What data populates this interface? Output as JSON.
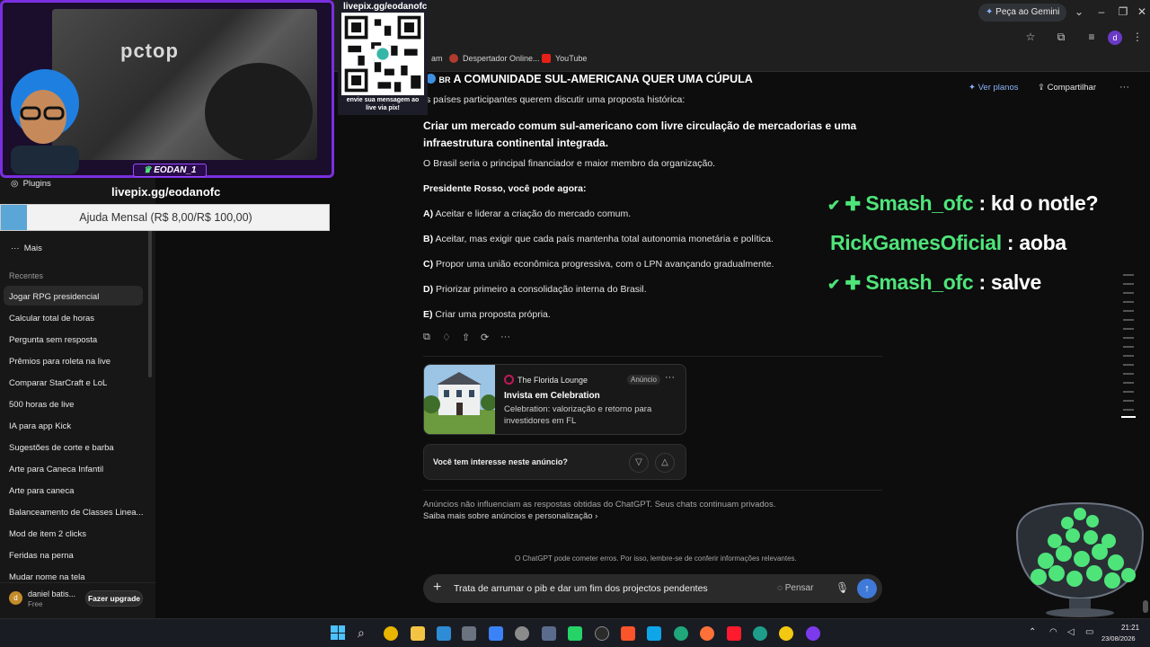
{
  "browser": {
    "gemini_label": "Peça ao Gemini",
    "bookmarks": [
      "am",
      "Despertador Online...",
      "YouTube"
    ],
    "profile_initial": "d"
  },
  "sidebar": {
    "plugins": "Plugins",
    "more": "Mais",
    "recents_heading": "Recentes",
    "items": [
      "Jogar RPG presidencial",
      "Calcular total de horas",
      "Pergunta sem resposta",
      "Prêmios para roleta na live",
      "Comparar StarCraft e LoL",
      "500 horas de live",
      "IA para app Kick",
      "Sugestões de corte e barba",
      "Arte para Caneca Infantil",
      "Arte para caneca",
      "Balanceamento de Classes Linea...",
      "Mod de item 2 clicks",
      "Feridas na perna",
      "Mudar nome na tela"
    ],
    "user_name": "daniel batis...",
    "user_plan": "Free",
    "user_initial": "d",
    "upgrade": "Fazer upgrade"
  },
  "header": {
    "see_plans": "Ver planos",
    "share": "Compartilhar",
    "more": "···"
  },
  "message": {
    "flag": "BR",
    "title": "A COMUNIDADE SUL-AMERICANA QUER UMA CÚPULA",
    "intro": "s países participantes querem discutir uma proposta histórica:",
    "proposal_1": "Criar um mercado comum sul-americano com livre circulação de mercadorias e uma",
    "proposal_2": "infraestrutura continental integrada.",
    "context": "O Brasil seria o principal financiador e maior membro da organização.",
    "prompt": "Presidente Rosso, você pode agora:",
    "options": [
      {
        "key": "A)",
        "text": "Aceitar e liderar a criação do mercado comum."
      },
      {
        "key": "B)",
        "text": "Aceitar, mas exigir que cada país mantenha total autonomia monetária e política."
      },
      {
        "key": "C)",
        "text": "Propor uma união econômica progressiva, com o LPN avançando gradualmente."
      },
      {
        "key": "D)",
        "text": "Priorizar primeiro a consolidação interna do Brasil."
      },
      {
        "key": "E)",
        "text": "Criar uma proposta própria."
      }
    ]
  },
  "ad": {
    "advertiser": "The Florida Lounge",
    "badge": "Anúncio",
    "headline": "Invista em Celebration",
    "body_1": "Celebration: valorização e retorno para",
    "body_2": "investidores em FL",
    "question": "Você tem interesse neste anúncio?",
    "disclaimer": "Anúncios não influenciam as respostas obtidas do ChatGPT. Seus chats continuam privados.",
    "learn_more": "Saiba mais sobre anúncios e personalização"
  },
  "footer_note": "O ChatGPT pode cometer erros. Por isso, lembre-se de conferir informações relevantes.",
  "composer": {
    "value": "Trata de arrumar o pib e dar um fim dos projectos pendentes",
    "think": "Pensar"
  },
  "overlay": {
    "cam_brand": "pctop",
    "streamer_tag": "EODAN_1",
    "livepix_under": "livepix.gg/eodanofc",
    "qr_title": "livepix.gg/eodanofc",
    "qr_caption_1": "envie sua mensagem ao",
    "qr_caption_2": "live via pix!",
    "goal": "Ajuda Mensal (R$ 8,00/R$ 100,00)",
    "goal_progress": 0.08,
    "chat": [
      {
        "user": "Smash_ofc",
        "msg": ": kd o notle?",
        "badges": true
      },
      {
        "user": "RickGamesOficial",
        "msg": ": aoba",
        "badges": false
      },
      {
        "user": "Smash_ofc",
        "msg": ": salve",
        "badges": true
      }
    ]
  },
  "taskbar": {
    "time": "21:21",
    "date": "23/08/2026"
  },
  "colors": {
    "accent": "#3f7ad8",
    "chat_user": "#4ee47a",
    "overlay_frame": "#7a2fe0"
  }
}
